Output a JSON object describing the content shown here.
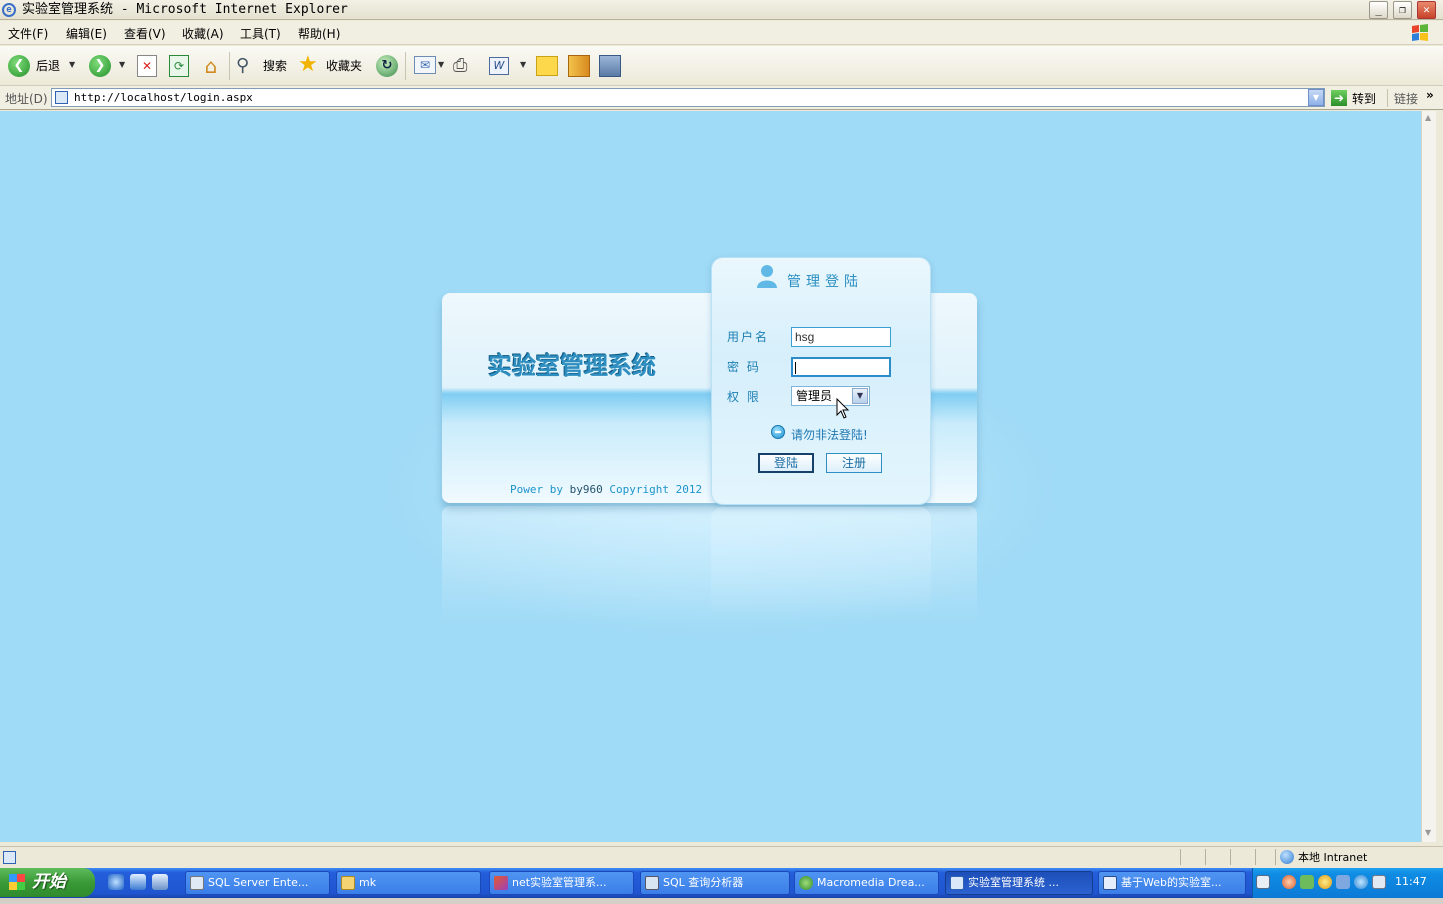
{
  "window": {
    "title": "实验室管理系统 - Microsoft Internet Explorer",
    "controls": [
      "_",
      "❐",
      "✕"
    ]
  },
  "menubar": {
    "items": [
      "文件(F)",
      "编辑(E)",
      "查看(V)",
      "收藏(A)",
      "工具(T)",
      "帮助(H)"
    ]
  },
  "toolbar": {
    "back_label": "后退",
    "search_label": "搜索",
    "favorites_label": "收藏夹"
  },
  "addressbar": {
    "label": "地址(D)",
    "url": "http://localhost/login.aspx",
    "go_label": "转到",
    "links_label": "链接"
  },
  "page": {
    "system_name": "实验室管理系统",
    "power_prefix": "Power by ",
    "power_author": "by960",
    "power_suffix": " Copyright 2012",
    "login_title": "管理登陆",
    "username_label": "用户名",
    "username_value": "hsg",
    "password_label": "密 码",
    "password_value": "",
    "role_label": "权 限",
    "role_value": "管理员",
    "warning": "请勿非法登陆!",
    "login_button": "登陆",
    "register_button": "注册"
  },
  "statusbar": {
    "zone": "本地 Intranet"
  },
  "taskbar": {
    "start_label": "开始",
    "tasks": [
      "SQL Server Ente...",
      "mk",
      "net实验室管理系...",
      "SQL 查询分析器",
      "Macromedia Drea...",
      "实验室管理系统 ...",
      "基于Web的实验室..."
    ],
    "active_task_index": 5,
    "clock": "11:47"
  },
  "colors": {
    "page_background": "#9fdaf6",
    "accent": "#2a8fc2",
    "taskbar": "#245edb"
  }
}
